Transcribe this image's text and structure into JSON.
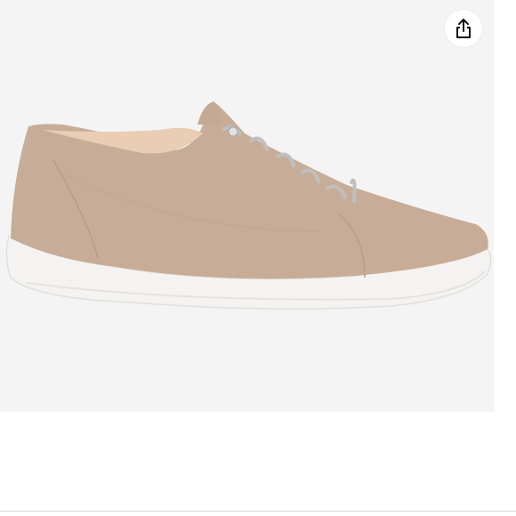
{
  "product_viewer": {
    "share_icon": "share-icon",
    "image_subject": "beige-suede-sneaker",
    "colors": {
      "background": "#f4f4f4",
      "suede": "#c7ad98",
      "sole": "#f4f3f1",
      "lace": "#bfbfbf"
    }
  }
}
